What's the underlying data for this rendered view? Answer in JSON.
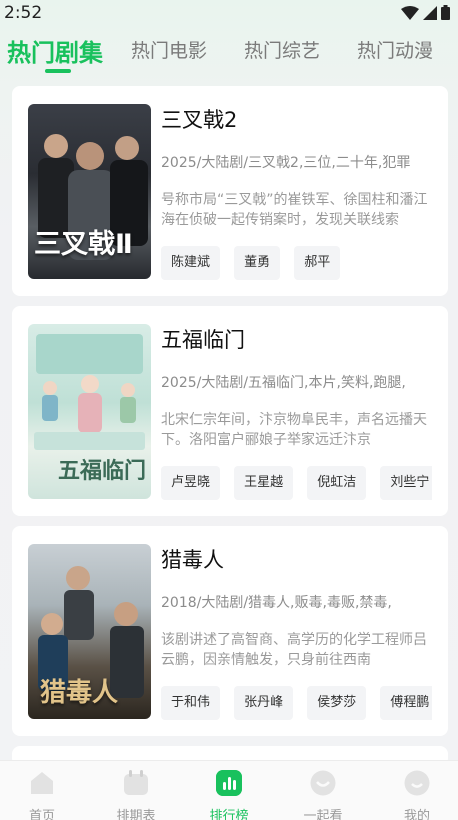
{
  "status_bar": {
    "time": "2:52"
  },
  "tabs": [
    {
      "label": "热门剧集",
      "active": true
    },
    {
      "label": "热门电影",
      "active": false
    },
    {
      "label": "热门综艺",
      "active": false
    },
    {
      "label": "热门动漫",
      "active": false
    }
  ],
  "dramas": [
    {
      "title": "三叉戟2",
      "poster_text": "三叉戟Ⅱ",
      "tags": "2025/大陆剧/三叉戟2,三位,二十年,犯罪",
      "description": "号称市局“三叉戟”的崔铁军、徐国柱和潘江海在侦破一起传销案时，发现关联线索",
      "actors": [
        "陈建斌",
        "董勇",
        "郝平"
      ]
    },
    {
      "title": "五福临门",
      "poster_text": "五福临门",
      "tags": "2025/大陆剧/五福临门,本片,笑料,跑腿,",
      "description": "北宋仁宗年间，汴京物阜民丰，声名远播天下。洛阳富户郦娘子举家远迁汴京",
      "actors": [
        "卢昱晓",
        "王星越",
        "倪虹洁",
        "刘些宁"
      ]
    },
    {
      "title": "猎毒人",
      "poster_text": "猎毒人",
      "tags": "2018/大陆剧/猎毒人,贩毒,毒贩,禁毒,",
      "description": "该剧讲述了高智商、高学历的化学工程师吕云鹏，因亲情触发，只身前往西南",
      "actors": [
        "于和伟",
        "张丹峰",
        "侯梦莎",
        "傅程鹏"
      ]
    }
  ],
  "bottom_nav": [
    {
      "label": "首页",
      "icon": "home-icon",
      "active": false
    },
    {
      "label": "排期表",
      "icon": "calendar-icon",
      "active": false
    },
    {
      "label": "排行榜",
      "icon": "ranking-icon",
      "active": true
    },
    {
      "label": "一起看",
      "icon": "watch-together-icon",
      "active": false
    },
    {
      "label": "我的",
      "icon": "profile-icon",
      "active": false
    }
  ],
  "colors": {
    "accent": "#19c15d",
    "inactive": "#9a9a9a"
  }
}
